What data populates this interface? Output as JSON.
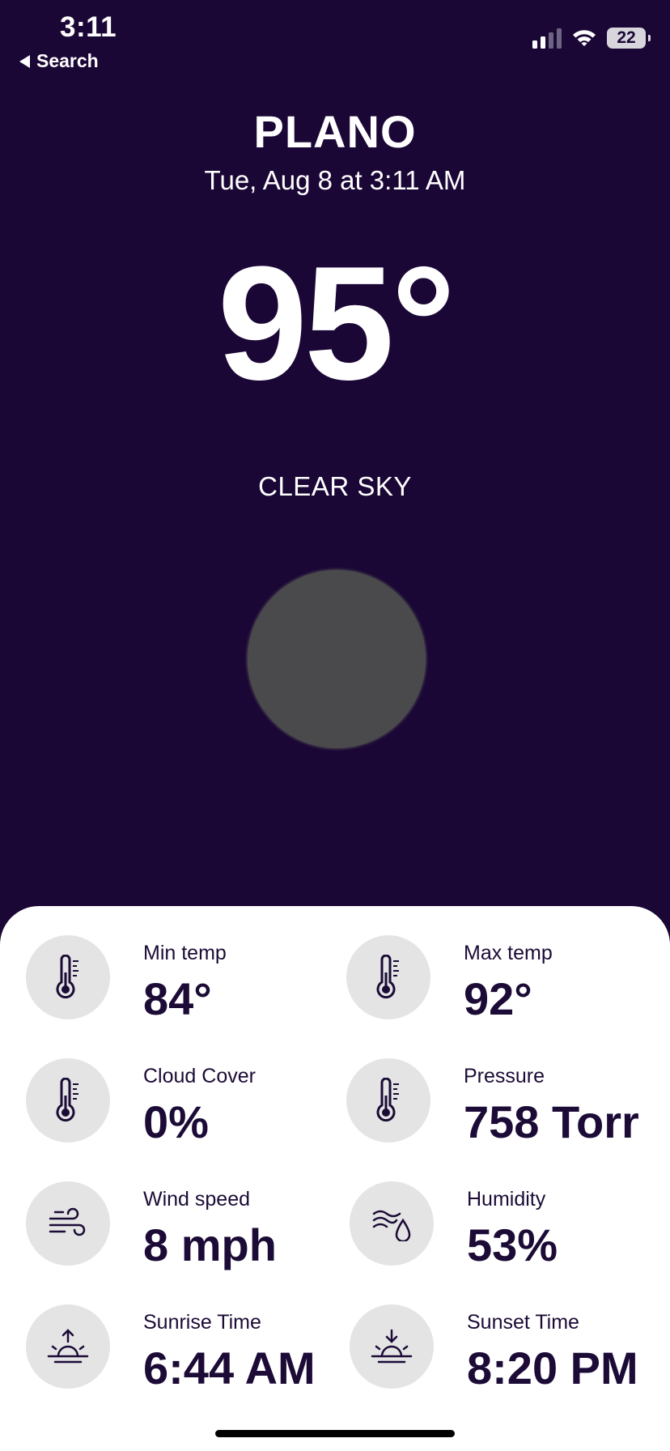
{
  "status_bar": {
    "time": "3:11",
    "back_label": "Search",
    "battery": "22"
  },
  "location": {
    "city": "PLANO",
    "datetime": "Tue, Aug 8 at 3:11 AM"
  },
  "current": {
    "temperature": "95°",
    "condition": "CLEAR SKY"
  },
  "stats": {
    "min_temp": {
      "label": "Min temp",
      "value": "84°",
      "icon": "thermometer-icon"
    },
    "max_temp": {
      "label": "Max temp",
      "value": "92°",
      "icon": "thermometer-icon"
    },
    "cloud_cover": {
      "label": "Cloud Cover",
      "value": "0%",
      "icon": "thermometer-icon"
    },
    "pressure": {
      "label": "Pressure",
      "value": "758 Torr",
      "icon": "thermometer-icon"
    },
    "wind_speed": {
      "label": "Wind speed",
      "value": "8 mph",
      "icon": "wind-icon"
    },
    "humidity": {
      "label": "Humidity",
      "value": "53%",
      "icon": "humidity-icon"
    },
    "sunrise": {
      "label": "Sunrise Time",
      "value": "6:44 AM",
      "icon": "sunrise-icon"
    },
    "sunset": {
      "label": "Sunset Time",
      "value": "8:20 PM",
      "icon": "sunset-icon"
    }
  },
  "colors": {
    "background": "#1b0736",
    "sheet": "#ffffff",
    "icon_circle": "#e4e4e4",
    "text_dark": "#1b0b36",
    "orb": "#4a4a4c"
  }
}
